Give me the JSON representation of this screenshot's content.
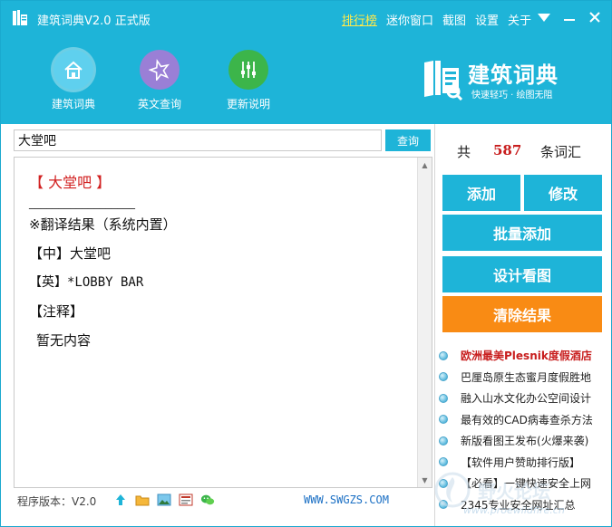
{
  "window": {
    "title": "建筑词典V2.0 正式版",
    "links": [
      "排行榜",
      "迷你窗口",
      "截图",
      "设置",
      "关于"
    ]
  },
  "toolbar": {
    "items": [
      {
        "label": "建筑词典",
        "icon": "home-icon",
        "color": "#5fd0ee"
      },
      {
        "label": "英文查询",
        "icon": "star-icon",
        "color": "#9a7fd6"
      },
      {
        "label": "更新说明",
        "icon": "sliders-icon",
        "color": "#3cb54a"
      }
    ]
  },
  "brand": {
    "name": "建筑词典",
    "slogan": "快速轻巧 · 绘图无阻"
  },
  "search": {
    "value": "大堂吧",
    "button_label": "查询"
  },
  "result": {
    "heading": "【  大堂吧  】",
    "divider": "__________________",
    "section_title": "※翻译结果（系统内置）",
    "cn_line": "【中】大堂吧",
    "en_line": "【英】*LOBBY BAR",
    "note_label": "【注释】",
    "note_text": "暂无内容"
  },
  "stats": {
    "prefix": "共",
    "count": "587",
    "suffix": "条词汇"
  },
  "actions": {
    "add": "添加",
    "edit": "修改",
    "batch_add": "批量添加",
    "design": "设计看图",
    "clear": "清除结果"
  },
  "ads": [
    "欧洲最美Plesnik度假酒店",
    "巴厘岛原生态蜜月度假胜地",
    "融入山水文化办公空间设计",
    "最有效的CAD病毒查杀方法",
    "新版看图王发布(火爆来袭)",
    "【软件用户赞助排行版】",
    "【必看】一键快速安全上网",
    "2345专业安全网址汇总"
  ],
  "status": {
    "version": "程序版本：V2.0",
    "url": "WWW.SWGZS.COM"
  },
  "watermark": {
    "text": "野火论坛",
    "url": "www.proewildfire.cn"
  },
  "colors": {
    "primary": "#1eb4d8",
    "accent": "#f98b14",
    "highlight": "#c81e1e"
  }
}
